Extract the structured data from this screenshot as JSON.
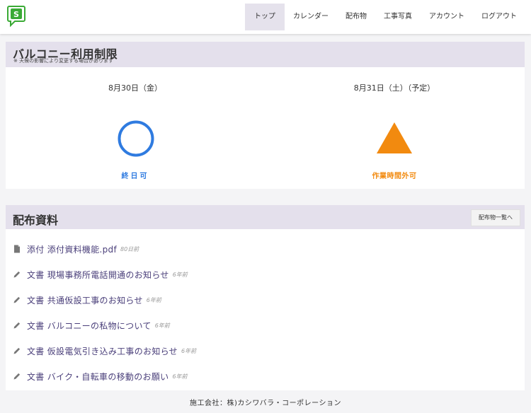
{
  "header": {
    "logo_letter": "S",
    "brand_color": "#3aaa35",
    "nav": [
      {
        "label": "トップ",
        "active": true
      },
      {
        "label": "カレンダー"
      },
      {
        "label": "配布物"
      },
      {
        "label": "工事写真"
      },
      {
        "label": "アカウント"
      },
      {
        "label": "ログアウト"
      }
    ]
  },
  "balcony": {
    "title": "バルコニー利用制限",
    "note": "※ 天候の影響により変更する場合があります",
    "days": [
      {
        "date": "8月30日（金）",
        "status": "終日可",
        "symbol": "circle-icon",
        "color": "#2f7be0"
      },
      {
        "date": "8月31日（土）（予定）",
        "status": "作業時間外可",
        "symbol": "triangle-icon",
        "color": "#f28a0f"
      }
    ]
  },
  "docs": {
    "title": "配布資料",
    "list_button": "配布物一覧へ",
    "items": [
      {
        "icon": "file-icon",
        "text": "添付 添付資料機能.pdf",
        "age": "80日前"
      },
      {
        "icon": "pencil-icon",
        "text": "文書 現場事務所電話開通のお知らせ",
        "age": "6年前"
      },
      {
        "icon": "pencil-icon",
        "text": "文書 共通仮設工事のお知らせ",
        "age": "6年前"
      },
      {
        "icon": "pencil-icon",
        "text": "文書 バルコニーの私物について",
        "age": "6年前"
      },
      {
        "icon": "pencil-icon",
        "text": "文書 仮設電気引き込み工事のお知らせ",
        "age": "6年前"
      },
      {
        "icon": "pencil-icon",
        "text": "文書 バイク・自転車の移動のお願い",
        "age": "6年前"
      }
    ]
  },
  "footer": {
    "text": "施工会社：株)カシワバラ・コーポレーション"
  }
}
